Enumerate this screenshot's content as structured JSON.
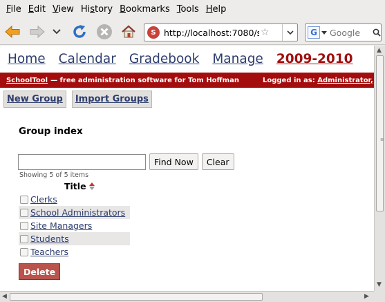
{
  "menu": [
    "File",
    "Edit",
    "View",
    "History",
    "Bookmarks",
    "Tools",
    "Help"
  ],
  "menu_accel": [
    "F",
    "E",
    "V",
    "s",
    "B",
    "T",
    "H"
  ],
  "toolbar": {
    "back_icon": "back-arrow-icon",
    "forward_icon": "forward-arrow-icon",
    "history_dropdown_icon": "chevron-down-icon",
    "reload_icon": "reload-icon",
    "stop_icon": "stop-icon",
    "home_icon": "home-icon",
    "url": "http://localhost:7080/s",
    "search_engine": "G",
    "search_placeholder": "Google"
  },
  "page": {
    "nav": [
      "Home",
      "Calendar",
      "Gradebook",
      "Manage",
      "2009-2010"
    ],
    "brand": "SchoolTool",
    "tagline": "— free administration software for Tom Hoffman",
    "logged_in_label": "Logged in as:",
    "logged_in_user": "Administrator,",
    "actions": [
      "New Group",
      "Import Groups"
    ],
    "heading": "Group index",
    "find_button": "Find Now",
    "clear_button": "Clear",
    "showing": "Showing 5 of 5 items",
    "column_title": "Title",
    "groups": [
      "Clerks",
      "School Administrators",
      "Site Managers",
      "Students",
      "Teachers"
    ],
    "delete_button": "Delete"
  },
  "colors": {
    "brand_red": "#a40d0d",
    "link_blue": "#2d3d6e",
    "delete_red": "#b9534b"
  }
}
